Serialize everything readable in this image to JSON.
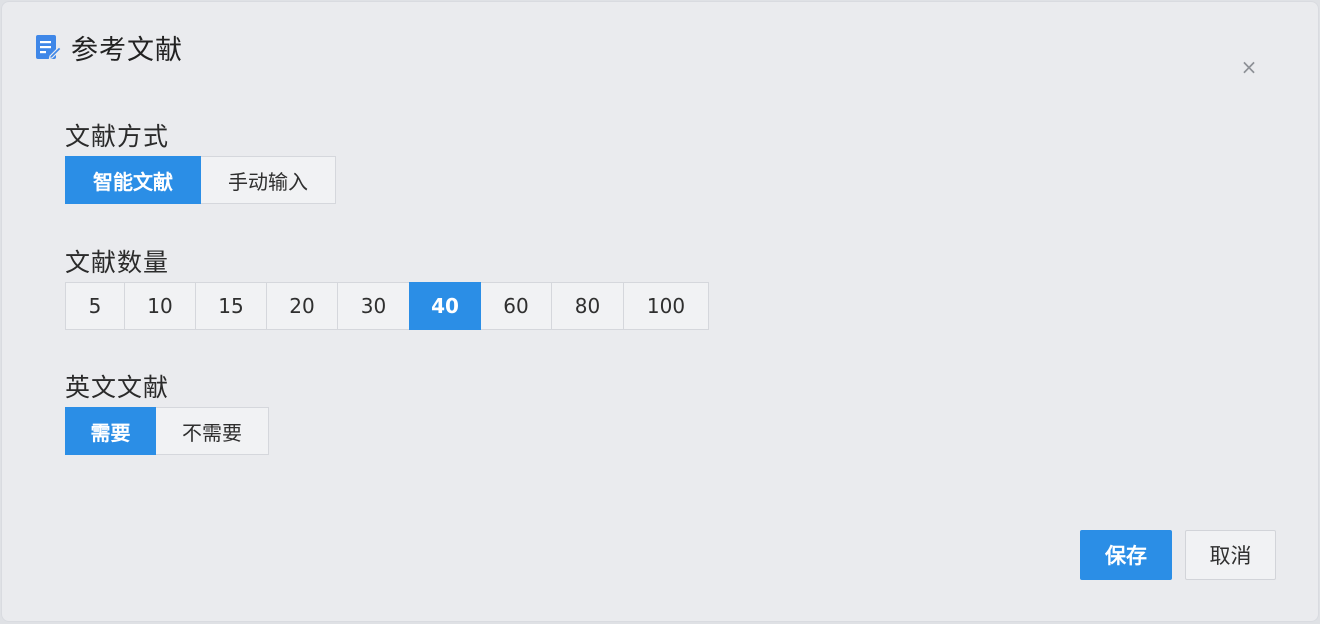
{
  "dialog": {
    "title": "参考文献",
    "close_label": "×"
  },
  "method": {
    "label": "文献方式",
    "options": [
      "智能文献",
      "手动输入"
    ],
    "selected": "智能文献"
  },
  "count": {
    "label": "文献数量",
    "options": [
      "5",
      "10",
      "15",
      "20",
      "30",
      "40",
      "60",
      "80",
      "100"
    ],
    "selected": "40"
  },
  "english": {
    "label": "英文文献",
    "options": [
      "需要",
      "不需要"
    ],
    "selected": "需要"
  },
  "actions": {
    "save_label": "保存",
    "cancel_label": "取消"
  },
  "colors": {
    "accent": "#2b8ee6",
    "background": "#eaebee"
  },
  "icons": {
    "title_icon": "document-edit-icon",
    "close_icon": "close-icon"
  }
}
